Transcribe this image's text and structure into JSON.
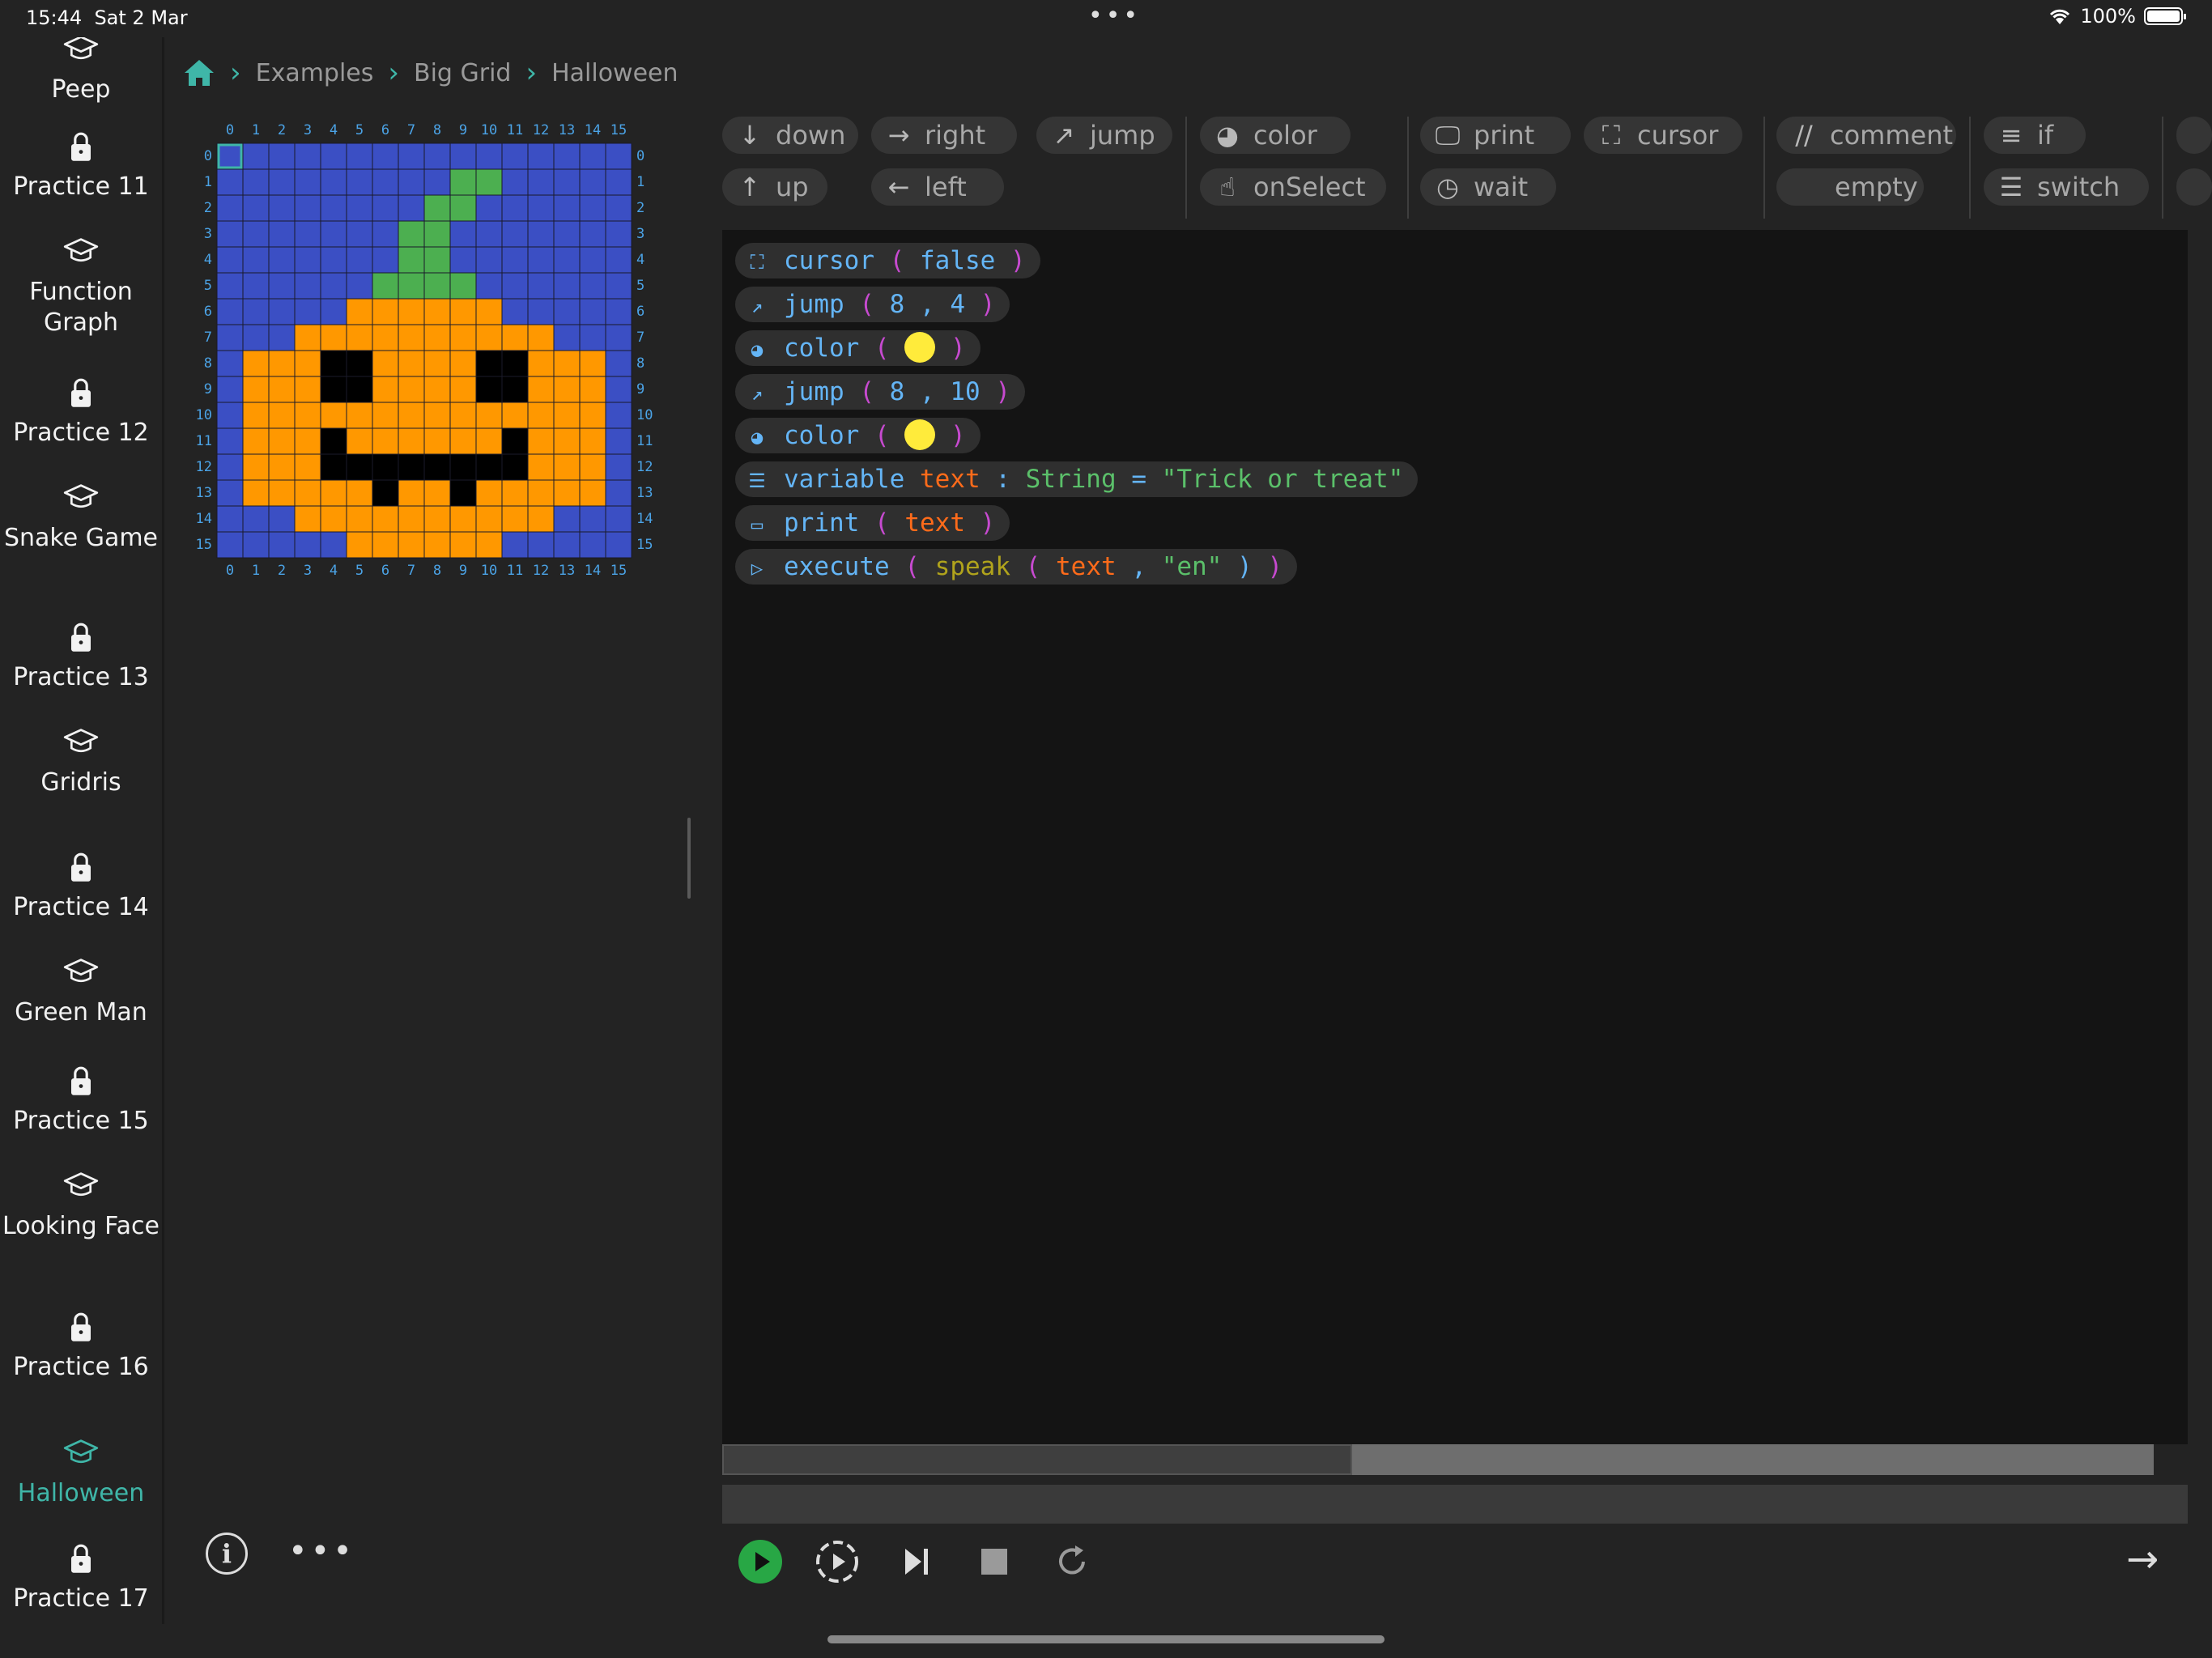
{
  "status_bar": {
    "time": "15:44",
    "date": "Sat 2 Mar",
    "battery": "100%"
  },
  "sidebar": {
    "items": [
      {
        "label": "Peep",
        "icon": "mortarboard-icon"
      },
      {
        "label": "Practice 11",
        "icon": "lock-icon"
      },
      {
        "label": "Function Graph",
        "icon": "mortarboard-icon"
      },
      {
        "label": "Practice 12",
        "icon": "lock-icon"
      },
      {
        "label": "Snake Game",
        "icon": "mortarboard-icon"
      },
      {
        "label": "Practice 13",
        "icon": "lock-icon"
      },
      {
        "label": "Gridris",
        "icon": "mortarboard-icon"
      },
      {
        "label": "Practice 14",
        "icon": "lock-icon"
      },
      {
        "label": "Green Man",
        "icon": "mortarboard-icon"
      },
      {
        "label": "Practice 15",
        "icon": "lock-icon"
      },
      {
        "label": "Looking Face",
        "icon": "mortarboard-icon"
      },
      {
        "label": "Practice 16",
        "icon": "lock-icon"
      },
      {
        "label": "Halloween",
        "icon": "mortarboard-icon",
        "active": true
      },
      {
        "label": "Practice 17",
        "icon": "lock-icon"
      }
    ]
  },
  "breadcrumb": {
    "items": [
      "Examples",
      "Big Grid",
      "Halloween"
    ]
  },
  "grid": {
    "size": 16,
    "axis_labels": [
      "0",
      "1",
      "2",
      "3",
      "4",
      "5",
      "6",
      "7",
      "8",
      "9",
      "10",
      "11",
      "12",
      "13",
      "14",
      "15"
    ],
    "palette": {
      "B": "#3b4fc4",
      "G": "#4caf50",
      "O": "#ff9800",
      "K": "#000000"
    },
    "rows": [
      "BBBBBBBBBBBBBBBB",
      "BBBBBBBBBGGBBBBB",
      "BBBBBBBBGGBBBBBB",
      "BBBBBBBGGBBBBBBB",
      "BBBBBBBGGBBBBBBB",
      "BBBBBBGGGGBBBBBB",
      "BBBBBOOOOOOBBBBB",
      "BBBOOOOOOOOOOBBB",
      "BOOOKKOOOOKKOOOB",
      "BOOOKKOOOOKKOOOB",
      "BOOOOOOOOOOOOOOB",
      "BOOOKOOOOOOKOOOB",
      "BOOOKKKKKKKKOOOB",
      "BOOOOOKOOKOOOOOB",
      "BBBOOOOOOOOOOBBB",
      "BBBBBOOOOOOBBBBB"
    ],
    "cursor": [
      0,
      0
    ]
  },
  "toolbar": {
    "down": "down",
    "up": "up",
    "right": "right",
    "left": "left",
    "jump": "jump",
    "color": "color",
    "onSelect": "onSelect",
    "print": "print",
    "wait": "wait",
    "cursor": "cursor",
    "comment": "comment",
    "comment_prefix": "//",
    "empty": "empty",
    "if": "if",
    "switch": "switch"
  },
  "code": {
    "line1": {
      "kw": "cursor",
      "open": "(",
      "arg": "false",
      "close": ")"
    },
    "line2": {
      "kw": "jump",
      "open": "(",
      "a": "8",
      "sep": ",",
      "b": "4",
      "close": ")"
    },
    "line3": {
      "kw": "color",
      "open": "(",
      "close": ")",
      "swatch": "#ffeb3b"
    },
    "line4": {
      "kw": "jump",
      "open": "(",
      "a": "8",
      "sep": ",",
      "b": "10",
      "close": ")"
    },
    "line5": {
      "kw": "color",
      "open": "(",
      "close": ")",
      "swatch": "#ffeb3b"
    },
    "line6": {
      "kw": "variable",
      "name": "text",
      "colon": ":",
      "type": "String",
      "eq": "=",
      "value": "\"Trick or treat\""
    },
    "line7": {
      "kw": "print",
      "open": "(",
      "arg": "text",
      "close": ")"
    },
    "line8": {
      "kw": "execute",
      "open": "(",
      "fn": "speak",
      "open2": "(",
      "arg": "text",
      "sep": ",",
      "lang": "\"en\"",
      "close2": ")",
      "close": ")"
    }
  },
  "scroll": {
    "position": 0.44
  },
  "colors": {
    "accent": "#3fb6a8",
    "run": "#28a745"
  }
}
